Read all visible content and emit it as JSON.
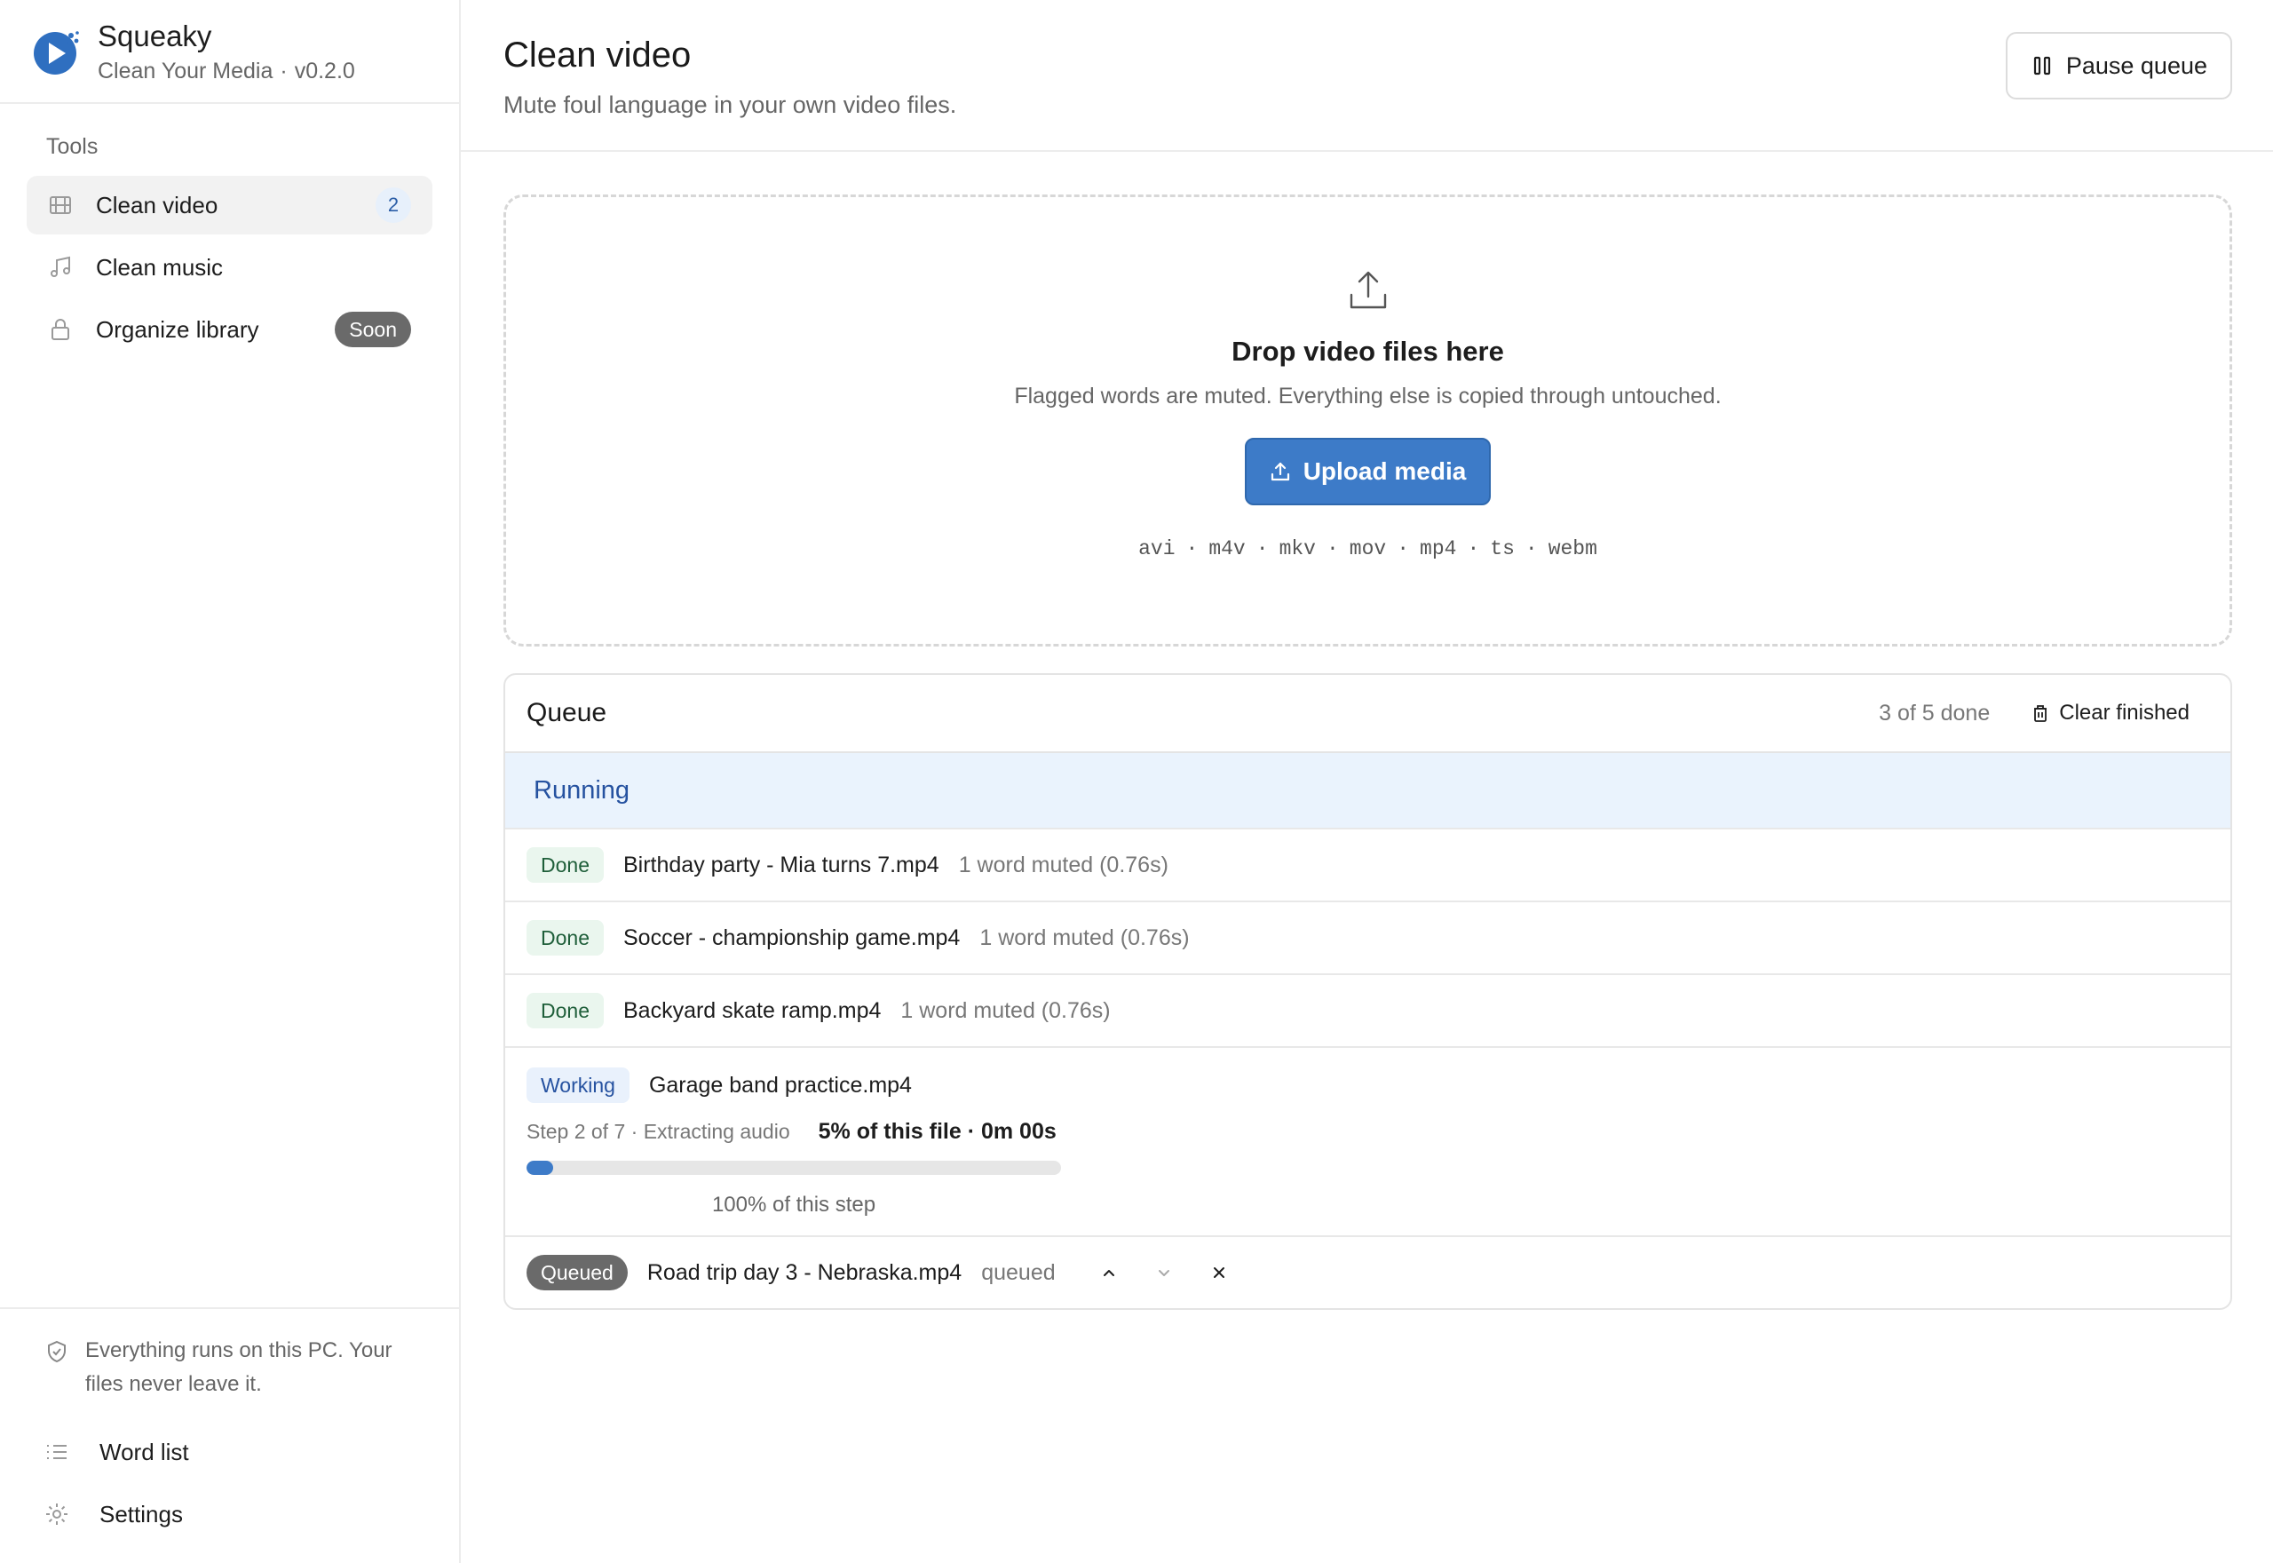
{
  "app": {
    "name": "Squeaky",
    "subtitle": "Clean Your Media",
    "dot": "·",
    "version": "v0.2.0"
  },
  "colors": {
    "accent": "#3d7bc8",
    "running_bg": "#eaf3fd",
    "done_bg": "#eaf6ee"
  },
  "sidebar": {
    "heading": "Tools",
    "items": [
      {
        "label": "Clean video",
        "icon": "film-icon",
        "badge": "2",
        "active": true
      },
      {
        "label": "Clean music",
        "icon": "music-note-icon"
      },
      {
        "label": "Organize library",
        "icon": "lock-icon",
        "badge": "Soon"
      }
    ],
    "privacy": "Everything runs on this PC. Your files never leave it.",
    "footer": [
      {
        "label": "Word list",
        "icon": "list-icon"
      },
      {
        "label": "Settings",
        "icon": "gear-icon"
      }
    ]
  },
  "header": {
    "title": "Clean video",
    "subtitle": "Mute foul language in your own video files.",
    "pause_label": "Pause queue"
  },
  "dropzone": {
    "title": "Drop video files here",
    "subtitle": "Flagged words are muted. Everything else is copied through untouched.",
    "upload_label": "Upload media",
    "formats": [
      "avi",
      "m4v",
      "mkv",
      "mov",
      "mp4",
      "ts",
      "webm"
    ]
  },
  "queue": {
    "title": "Queue",
    "count": "3 of 5 done",
    "clear_label": "Clear finished",
    "section": "Running",
    "done_items": [
      {
        "status": "Done",
        "name": "Birthday party - Mia turns 7.mp4",
        "meta": "1 word muted (0.76s)"
      },
      {
        "status": "Done",
        "name": "Soccer - championship game.mp4",
        "meta": "1 word muted (0.76s)"
      },
      {
        "status": "Done",
        "name": "Backyard skate ramp.mp4",
        "meta": "1 word muted (0.76s)"
      }
    ],
    "working": {
      "status": "Working",
      "name": "Garage band practice.mp4",
      "step": "Step 2 of 7 · Extracting audio",
      "file_progress": "5% of this file · 0m 00s",
      "progress_fraction": 0.05,
      "step_progress": "100% of this step"
    },
    "queued": {
      "status": "Queued",
      "name": "Road trip day 3 - Nebraska.mp4",
      "meta": "queued"
    }
  }
}
